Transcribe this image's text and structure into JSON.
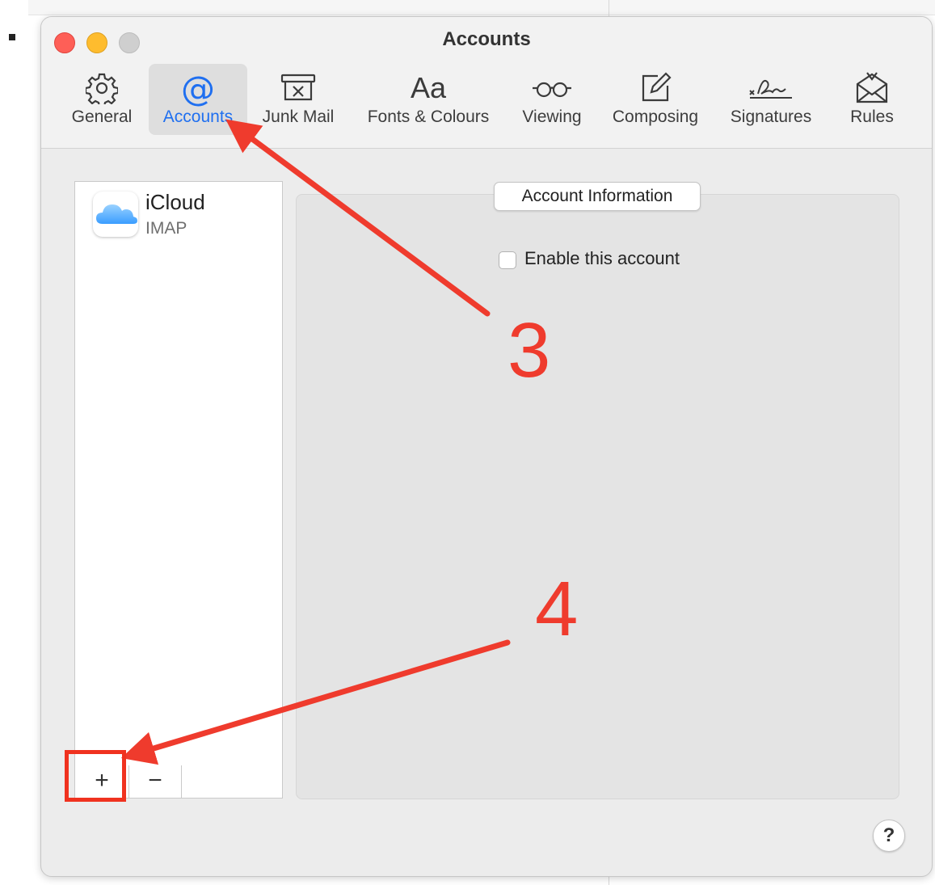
{
  "window": {
    "title": "Accounts"
  },
  "toolbar": {
    "tabs": [
      {
        "label": "General",
        "icon": "gear-icon",
        "selected": false
      },
      {
        "label": "Accounts",
        "icon": "at-sign-icon",
        "selected": true
      },
      {
        "label": "Junk Mail",
        "icon": "junk-bin-icon",
        "selected": false
      },
      {
        "label": "Fonts & Colours",
        "icon": "fonts-icon",
        "glyph": "Aa",
        "selected": false
      },
      {
        "label": "Viewing",
        "icon": "glasses-icon",
        "glyph": "oo",
        "selected": false
      },
      {
        "label": "Composing",
        "icon": "compose-icon",
        "selected": false
      },
      {
        "label": "Signatures",
        "icon": "signature-icon",
        "selected": false
      },
      {
        "label": "Rules",
        "icon": "rules-envelope-icon",
        "selected": false
      }
    ]
  },
  "accounts_list": {
    "items": [
      {
        "name": "iCloud",
        "type": "IMAP",
        "icon": "icloud-icon"
      }
    ],
    "add_label": "+",
    "remove_label": "−"
  },
  "info_panel": {
    "tab_label": "Account Information",
    "enable_label": "Enable this account",
    "enable_checked": false
  },
  "help_label": "?",
  "annotations": {
    "step3": "3",
    "step4": "4",
    "color": "#ef3b2d"
  },
  "colors": {
    "selected_tab": "#1f6ff0",
    "close": "#fe5f57",
    "minimize": "#febc2e"
  }
}
